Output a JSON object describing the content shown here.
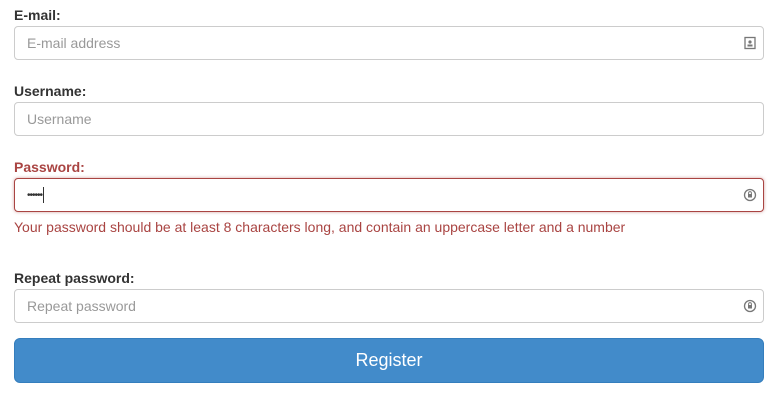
{
  "email": {
    "label": "E-mail:",
    "placeholder": "E-mail address"
  },
  "username": {
    "label": "Username:",
    "placeholder": "Username"
  },
  "password": {
    "label": "Password:",
    "value": "••••••",
    "error": "Your password should be at least 8 characters long, and contain an uppercase letter and a number"
  },
  "repeat": {
    "label": "Repeat password:",
    "placeholder": "Repeat password"
  },
  "register_label": "Register",
  "colors": {
    "accent": "#428bca",
    "error": "#a94442"
  }
}
